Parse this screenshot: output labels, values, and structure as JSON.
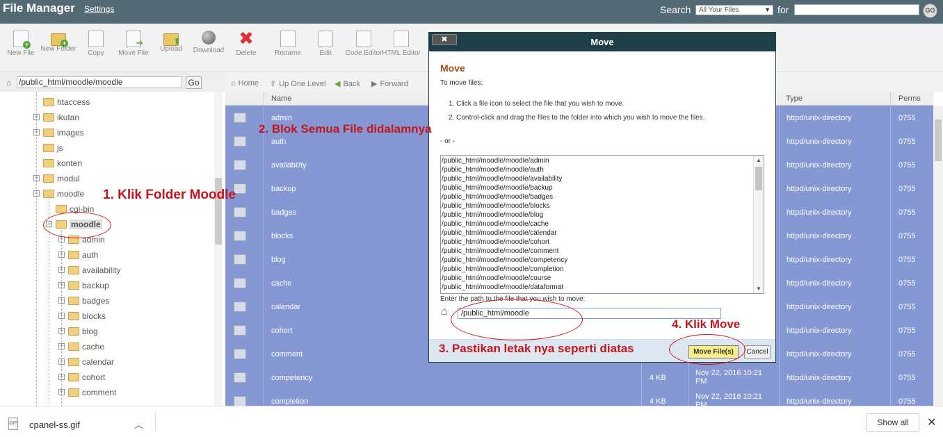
{
  "topbar": {
    "title": "File Manager",
    "settings": "Settings",
    "search_label": "Search",
    "search_scope": "All Your Files",
    "for_label": "for",
    "go": "GO"
  },
  "toolbar": [
    {
      "label": "New File",
      "icon": "new-file-icon"
    },
    {
      "label": "New Folder",
      "icon": "new-folder-icon"
    },
    {
      "label": "Copy",
      "icon": "copy-icon"
    },
    {
      "label": "Move File",
      "icon": "move-file-icon"
    },
    {
      "label": "Upload",
      "icon": "upload-icon"
    },
    {
      "label": "Download",
      "icon": "download-icon"
    },
    {
      "label": "Delete",
      "icon": "delete-icon"
    },
    {
      "label": "Rename",
      "icon": "rename-icon"
    },
    {
      "label": "Edit",
      "icon": "edit-icon"
    },
    {
      "label": "Code Editor",
      "icon": "code-editor-icon"
    },
    {
      "label": "HTML Editor",
      "icon": "html-editor-icon"
    }
  ],
  "pathbar": {
    "path": "/public_html/moodle/moodle",
    "go": "Go"
  },
  "navbar": {
    "home": "Home",
    "up": "Up One Level",
    "back": "Back",
    "forward": "Forward"
  },
  "tree": [
    {
      "label": "htaccess",
      "toggle": ""
    },
    {
      "label": "ikutan",
      "toggle": "+"
    },
    {
      "label": "images",
      "toggle": "+"
    },
    {
      "label": "js",
      "toggle": ""
    },
    {
      "label": "konten",
      "toggle": ""
    },
    {
      "label": "modul",
      "toggle": "+"
    },
    {
      "label": "moodle",
      "toggle": "−"
    },
    {
      "label": "cgi-bin",
      "toggle": ""
    },
    {
      "label": "moodle",
      "toggle": "−"
    },
    {
      "label": "admin",
      "toggle": "+"
    },
    {
      "label": "auth",
      "toggle": "+"
    },
    {
      "label": "availability",
      "toggle": "+"
    },
    {
      "label": "backup",
      "toggle": "+"
    },
    {
      "label": "badges",
      "toggle": "+"
    },
    {
      "label": "blocks",
      "toggle": "+"
    },
    {
      "label": "blog",
      "toggle": "+"
    },
    {
      "label": "cache",
      "toggle": "+"
    },
    {
      "label": "calendar",
      "toggle": "+"
    },
    {
      "label": "cohort",
      "toggle": "+"
    },
    {
      "label": "comment",
      "toggle": "+"
    }
  ],
  "list": {
    "headers": {
      "name": "Name",
      "type": "Type",
      "perms": "Perms"
    },
    "rows": [
      {
        "name": "admin",
        "size": "",
        "date": "",
        "type": "httpd/unix-directory",
        "perms": "0755"
      },
      {
        "name": "auth",
        "size": "",
        "date": "",
        "type": "httpd/unix-directory",
        "perms": "0755"
      },
      {
        "name": "availability",
        "size": "",
        "date": "",
        "type": "httpd/unix-directory",
        "perms": "0755"
      },
      {
        "name": "backup",
        "size": "",
        "date": "",
        "type": "httpd/unix-directory",
        "perms": "0755"
      },
      {
        "name": "badges",
        "size": "",
        "date": "",
        "type": "httpd/unix-directory",
        "perms": "0755"
      },
      {
        "name": "blocks",
        "size": "",
        "date": "",
        "type": "httpd/unix-directory",
        "perms": "0755"
      },
      {
        "name": "blog",
        "size": "",
        "date": "",
        "type": "httpd/unix-directory",
        "perms": "0755"
      },
      {
        "name": "cache",
        "size": "",
        "date": "",
        "type": "httpd/unix-directory",
        "perms": "0755"
      },
      {
        "name": "calendar",
        "size": "",
        "date": "",
        "type": "httpd/unix-directory",
        "perms": "0755"
      },
      {
        "name": "cohort",
        "size": "",
        "date": "",
        "type": "httpd/unix-directory",
        "perms": "0755"
      },
      {
        "name": "comment",
        "size": "",
        "date": "",
        "type": "httpd/unix-directory",
        "perms": "0755"
      },
      {
        "name": "competency",
        "size": "4 KB",
        "date": "Nov 22, 2016 10:21 PM",
        "type": "httpd/unix-directory",
        "perms": "0755"
      },
      {
        "name": "completion",
        "size": "4 KB",
        "date": "Nov 22, 2016 10:21 PM",
        "type": "httpd/unix-directory",
        "perms": "0755"
      }
    ]
  },
  "modal": {
    "title": "Move",
    "close": "✖",
    "heading": "Move",
    "instructions": "To move files:",
    "step1": "1. Click a file icon to select the file that you wish to move.",
    "step2": "2. Control-click and drag the files to the folder into which you wish to move the files.",
    "or": "- or -",
    "files": [
      "/public_html/moodle/moodle/admin",
      "/public_html/moodle/moodle/auth",
      "/public_html/moodle/moodle/availability",
      "/public_html/moodle/moodle/backup",
      "/public_html/moodle/moodle/badges",
      "/public_html/moodle/moodle/blocks",
      "/public_html/moodle/moodle/blog",
      "/public_html/moodle/moodle/cache",
      "/public_html/moodle/moodle/calendar",
      "/public_html/moodle/moodle/cohort",
      "/public_html/moodle/moodle/comment",
      "/public_html/moodle/moodle/competency",
      "/public_html/moodle/moodle/completion",
      "/public_html/moodle/moodle/course",
      "/public_html/moodle/moodle/dataformat"
    ],
    "path_label": "Enter the path to the file that you wish to move:",
    "path_value": "/public_html/moodle",
    "move_button": "Move File(s)",
    "cancel_button": "Cancel"
  },
  "annotations": {
    "a1": "1. Klik Folder Moodle",
    "a2": "2. Blok Semua File didalamnya",
    "a3": "3. Pastikan letak nya seperti diatas",
    "a4": "4. Klik Move"
  },
  "downloads": {
    "filename": "cpanel-ss.gif",
    "show_all": "Show all"
  },
  "colors": {
    "topbar": "#536a74",
    "selection": "#8598d4",
    "modal_header": "#1f3f48",
    "annotation": "#c4161c"
  }
}
